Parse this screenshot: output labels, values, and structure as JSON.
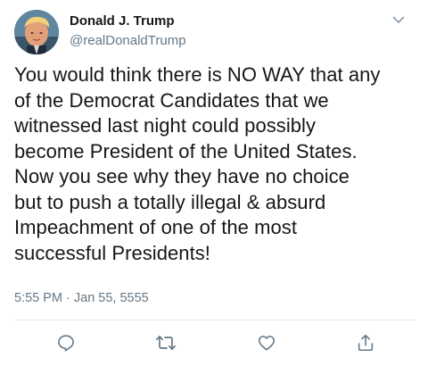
{
  "tweet": {
    "author_name": "Donald J. Trump",
    "author_handle": "@realDonaldTrump",
    "text": "You would think there is NO WAY that any\nof the Democrat Candidates that we\nwitnessed last night could possibly\nbecome President of the United States.\nNow you see why they have no choice\nbut to push a totally illegal & absurd\nImpeachment of one of the most\nsuccessful Presidents!",
    "timestamp": "5:55 PM · Jan 55, 5555"
  },
  "actions": {
    "reply_icon": "reply-icon",
    "retweet_icon": "retweet-icon",
    "like_icon": "heart-icon",
    "share_icon": "share-icon"
  },
  "colors": {
    "text": "#14171a",
    "secondary": "#657786",
    "divider": "#e1e8ed",
    "icon": "#657786"
  }
}
